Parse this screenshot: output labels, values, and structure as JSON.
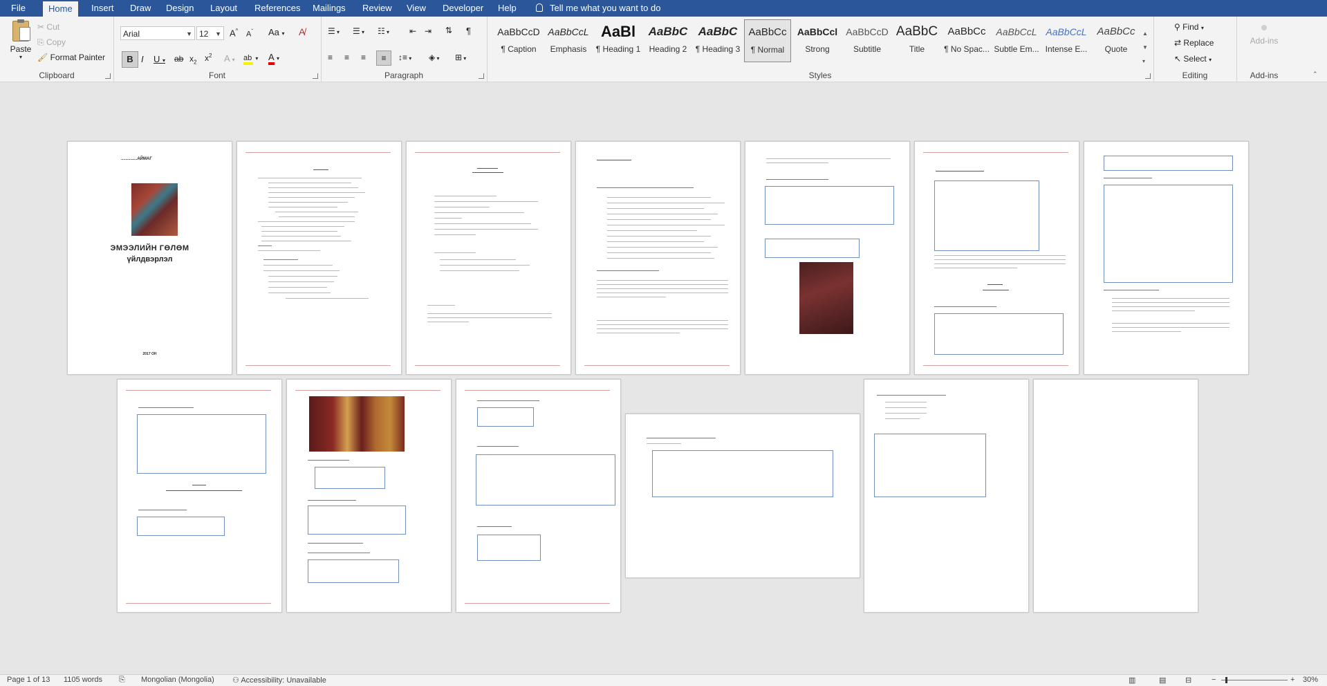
{
  "tabs": [
    {
      "label": "File",
      "active": false
    },
    {
      "label": "Home",
      "active": true
    },
    {
      "label": "Insert",
      "active": false
    },
    {
      "label": "Draw",
      "active": false
    },
    {
      "label": "Design",
      "active": false
    },
    {
      "label": "Layout",
      "active": false
    },
    {
      "label": "References",
      "active": false
    },
    {
      "label": "Mailings",
      "active": false
    },
    {
      "label": "Review",
      "active": false
    },
    {
      "label": "View",
      "active": false
    },
    {
      "label": "Developer",
      "active": false
    },
    {
      "label": "Help",
      "active": false
    }
  ],
  "tell_me": "Tell me what you want to do",
  "clipboard": {
    "paste": "Paste",
    "cut": "Cut",
    "copy": "Copy",
    "format_painter": "Format Painter",
    "label": "Clipboard"
  },
  "font": {
    "name": "Arial",
    "size": "12",
    "label": "Font",
    "case_label": "Aa"
  },
  "paragraph": {
    "label": "Paragraph"
  },
  "styles": {
    "label": "Styles",
    "items": [
      {
        "preview": "AaBbCcD",
        "name": "¶ Caption"
      },
      {
        "preview": "AaBbCcL",
        "name": "Emphasis"
      },
      {
        "preview": "AaBl",
        "name": "¶ Heading 1"
      },
      {
        "preview": "AaBbC",
        "name": "Heading 2"
      },
      {
        "preview": "AaBbC",
        "name": "¶ Heading 3"
      },
      {
        "preview": "AaBbCc",
        "name": "¶ Normal"
      },
      {
        "preview": "AaBbCcl",
        "name": "Strong"
      },
      {
        "preview": "AaBbCcD",
        "name": "Subtitle"
      },
      {
        "preview": "AaBbC",
        "name": "Title"
      },
      {
        "preview": "AaBbCc",
        "name": "¶ No Spac..."
      },
      {
        "preview": "AaBbCcL",
        "name": "Subtle Em..."
      },
      {
        "preview": "AaBbCcL",
        "name": "Intense E..."
      },
      {
        "preview": "AaBbCc",
        "name": "Quote"
      }
    ]
  },
  "editing": {
    "find": "Find",
    "replace": "Replace",
    "select": "Select",
    "label": "Editing"
  },
  "addins": {
    "button": "Add-ins",
    "label": "Add-ins"
  },
  "cover_page": {
    "heading": "..............АЙМАГ",
    "title_line1": "ЭМЭЭЛИЙН  ГӨЛӨМ",
    "title_line2": "үйлдвэрлэл",
    "footer": "2017 ОН"
  },
  "status": {
    "page": "Page 1 of 13",
    "words": "1105 words",
    "language": "Mongolian (Mongolia)",
    "accessibility": "Accessibility: Unavailable",
    "zoom": "30%"
  }
}
